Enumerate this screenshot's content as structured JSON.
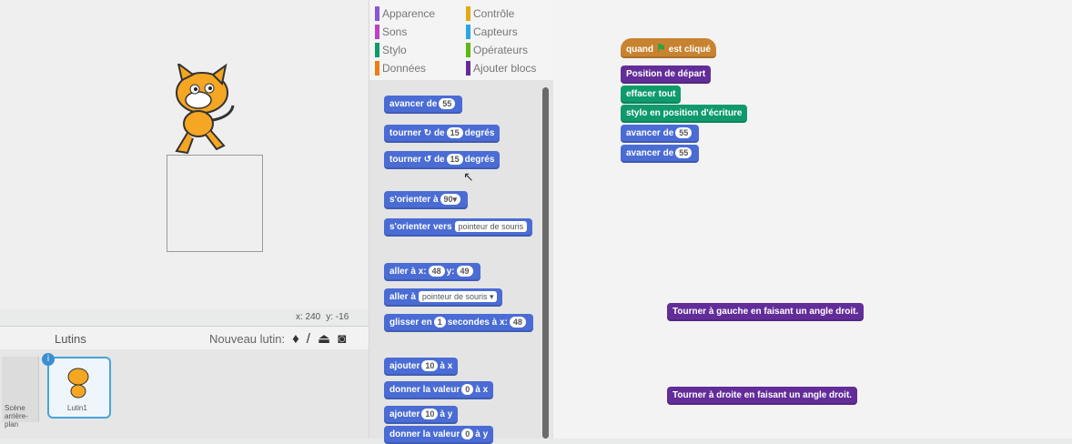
{
  "categories": [
    {
      "label": "Apparence",
      "color": "#8a55d7"
    },
    {
      "label": "Contrôle",
      "color": "#e1a91a"
    },
    {
      "label": "Sons",
      "color": "#bb42c3"
    },
    {
      "label": "Capteurs",
      "color": "#2ca5e2"
    },
    {
      "label": "Stylo",
      "color": "#0e9a6c"
    },
    {
      "label": "Opérateurs",
      "color": "#5cb712"
    },
    {
      "label": "Données",
      "color": "#ee7d16"
    },
    {
      "label": "Ajouter blocs",
      "color": "#632d99"
    }
  ],
  "palette": {
    "advance": {
      "text": "avancer de",
      "val": "55"
    },
    "turn_right": {
      "pre": "tourner",
      "icon": "↻",
      "mid": "de",
      "val": "15",
      "post": "degrés"
    },
    "turn_left": {
      "pre": "tourner",
      "icon": "↺",
      "mid": "de",
      "val": "15",
      "post": "degrés"
    },
    "orient": {
      "text": "s'orienter à",
      "val": "90▾"
    },
    "orient_to": {
      "text": "s'orienter vers",
      "drop": "pointeur de souris"
    },
    "goto_xy": {
      "text": "aller à x:",
      "x": "48",
      "ylabel": "y:",
      "y": "49"
    },
    "goto": {
      "text": "aller à",
      "drop": "pointeur de souris ▾"
    },
    "glide": {
      "text": "glisser en",
      "val": "1",
      "mid": "secondes à x:",
      "x": "48"
    },
    "add_x": {
      "text": "ajouter",
      "val": "10",
      "post": "à x"
    },
    "set_x": {
      "text": "donner la valeur",
      "val": "0",
      "post": "à x"
    },
    "add_y": {
      "text": "ajouter",
      "val": "10",
      "post": "à y"
    },
    "set_y": {
      "text": "donner la valeur",
      "val": "0",
      "post": "à y"
    }
  },
  "stage": {
    "x_label": "x: 240",
    "y_label": "y: -16"
  },
  "sprites": {
    "title": "Lutins",
    "new_sprite": "Nouveau lutin:",
    "sprite_name": "Lutin1",
    "stage_label": "Scène\narrière-plan"
  },
  "script": {
    "hat": {
      "pre": "quand",
      "post": "est cliqué"
    },
    "start": "Position de départ",
    "clear": "effacer tout",
    "pendown": "stylo en position d'écriture",
    "adv1": {
      "text": "avancer de",
      "val": "55"
    },
    "adv2": {
      "text": "avancer de",
      "val": "55"
    },
    "left": "Tourner à gauche en faisant un angle droit.",
    "right": "Tourner à droite en faisant un angle droit."
  }
}
